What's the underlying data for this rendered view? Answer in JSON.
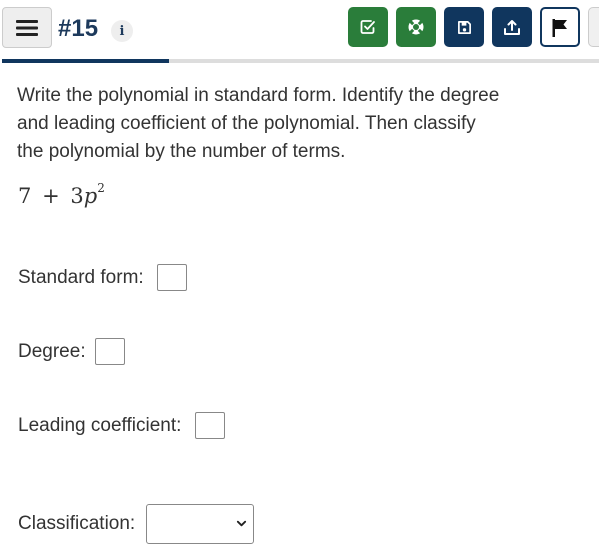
{
  "header": {
    "question_number": "#15",
    "info_glyph": "i",
    "menu_icon": "hamburger-menu-icon",
    "progress_fraction": 0.28,
    "toolbar": [
      {
        "name": "check-answer-button",
        "icon": "check-square-icon",
        "color": "#2a7d3a"
      },
      {
        "name": "help-button",
        "icon": "lifebuoy-icon",
        "color": "#2a7d3a"
      },
      {
        "name": "save-button",
        "icon": "save-icon",
        "color": "#10365e"
      },
      {
        "name": "submit-button",
        "icon": "upload-icon",
        "color": "#10365e"
      },
      {
        "name": "flag-button",
        "icon": "flag-icon",
        "color": "#10365e"
      }
    ]
  },
  "question": {
    "prompt_lines": [
      "Write the polynomial in standard form. Identify the degree",
      "and leading coefficient of the polynomial. Then classify",
      "the polynomial by the number of terms."
    ],
    "expression": {
      "constant": "7",
      "operator": "+",
      "coefficient": "3",
      "variable": "p",
      "exponent": "2"
    },
    "fields": {
      "standard_form_label": "Standard form:",
      "standard_form_value": "",
      "degree_label": "Degree:",
      "degree_value": "",
      "leading_coefficient_label": "Leading coefficient:",
      "leading_coefficient_value": "",
      "classification_label": "Classification:",
      "classification_selected": ""
    }
  },
  "colors": {
    "primary_navy": "#10365e",
    "primary_green": "#2a7d3a",
    "title_color": "#1d3a5c"
  }
}
